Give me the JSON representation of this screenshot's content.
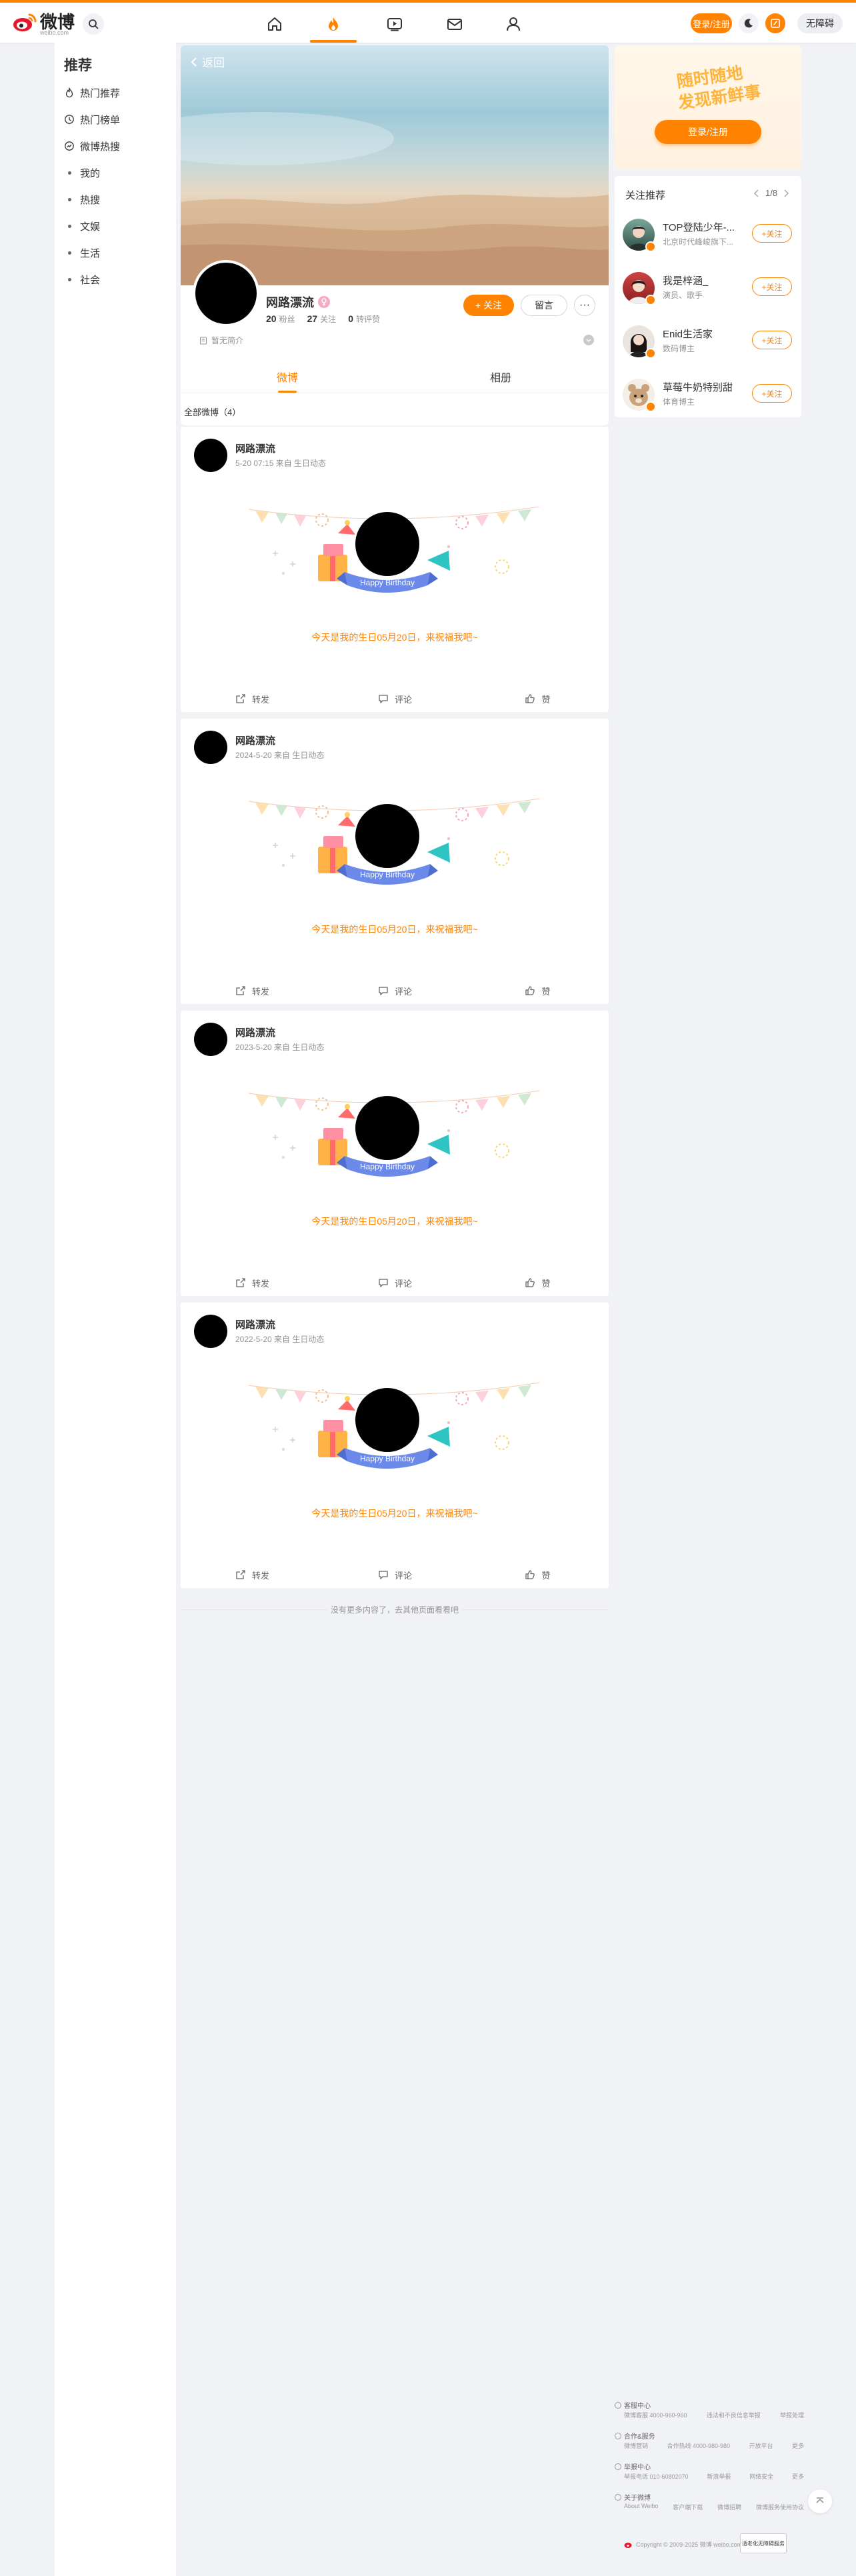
{
  "header": {
    "logo_text": "微博",
    "logo_sub": "weibo.com",
    "search_icon": "search-icon",
    "nav": [
      {
        "name": "home",
        "icon": "home-icon"
      },
      {
        "name": "hot",
        "icon": "flame-icon",
        "active": true
      },
      {
        "name": "video",
        "icon": "video-icon"
      },
      {
        "name": "message",
        "icon": "mail-icon"
      },
      {
        "name": "profile",
        "icon": "user-icon"
      }
    ],
    "login_label": "登录/注册",
    "accessible_label": "无障碍",
    "accent_color": "#ff8200"
  },
  "sidebar": {
    "title": "推荐",
    "items": [
      {
        "label": "热门推荐",
        "icon": "flame-outline-icon"
      },
      {
        "label": "热门榜单",
        "icon": "clock-icon"
      },
      {
        "label": "微博热搜",
        "icon": "search-outline-icon"
      },
      {
        "label": "我的",
        "icon": "dot"
      },
      {
        "label": "热搜",
        "icon": "dot"
      },
      {
        "label": "文娱",
        "icon": "dot"
      },
      {
        "label": "生活",
        "icon": "dot"
      },
      {
        "label": "社会",
        "icon": "dot"
      }
    ]
  },
  "profile": {
    "back_label": "返回",
    "name": "网路漂流",
    "stats": [
      {
        "value": "20",
        "label": "粉丝"
      },
      {
        "value": "27",
        "label": "关注"
      },
      {
        "value": "0",
        "label": "转评赞"
      }
    ],
    "follow_label": "+ 关注",
    "message_label": "留言",
    "more_label": "···",
    "intro": "暂无简介",
    "tabs": [
      {
        "label": "微博",
        "active": true
      },
      {
        "label": "相册",
        "active": false
      }
    ]
  },
  "feed": {
    "all_label": "全部微博（4）",
    "posts": [
      {
        "author": "网路漂流",
        "meta": "5-20 07:15 来自 生日动态",
        "text": "今天是我的生日05月20日，来祝福我吧~",
        "banner": "Happy Birthday"
      },
      {
        "author": "网路漂流",
        "meta": "2024-5-20 来自 生日动态",
        "text": "今天是我的生日05月20日，来祝福我吧~",
        "banner": "Happy Birthday"
      },
      {
        "author": "网路漂流",
        "meta": "2023-5-20 来自 生日动态",
        "text": "今天是我的生日05月20日，来祝福我吧~",
        "banner": "Happy Birthday"
      },
      {
        "author": "网路漂流",
        "meta": "2022-5-20 来自 生日动态",
        "text": "今天是我的生日05月20日，来祝福我吧~",
        "banner": "Happy Birthday"
      }
    ],
    "actions": {
      "repost": "转发",
      "comment": "评论",
      "like": "赞"
    },
    "end_text": "没有更多内容了，去其他页面看看吧"
  },
  "right": {
    "promo_line1": "随时随地",
    "promo_line2": "发现新鲜事",
    "promo_button": "登录/注册",
    "rec_title": "关注推荐",
    "rec_page": "1/8",
    "rec_items": [
      {
        "name": "TOP登陆少年-...",
        "desc": "北京时代峰峻旗下...",
        "follow": "+关注"
      },
      {
        "name": "我是梓涵_",
        "desc": "演员、歌手",
        "follow": "+关注"
      },
      {
        "name": "Enid生活家",
        "desc": "数码博主",
        "follow": "+关注"
      },
      {
        "name": "草莓牛奶特别甜",
        "desc": "体育博主",
        "follow": "+关注"
      }
    ]
  },
  "footer": {
    "sections": [
      {
        "title": "客服中心",
        "lines": [
          "微博客服 4000-960-960",
          "违法和不良信息举报",
          "举报处理"
        ]
      },
      {
        "title": "合作&服务",
        "lines": [
          "微博营销",
          "合作热线 4000-980-980",
          "开放平台",
          "更多"
        ]
      },
      {
        "title": "举报中心",
        "lines": [
          "举报电话 010-60802070",
          "新浪举报",
          "网络安全",
          "更多"
        ]
      },
      {
        "title": "关于微博",
        "lines": [
          "About Weibo",
          "客户端下载",
          "微博招聘",
          "微博服务使用协议"
        ]
      }
    ],
    "copyright": "Copyright © 2009-2025 微博 weibo.com",
    "badge_text": "适老化无障碍服务"
  }
}
